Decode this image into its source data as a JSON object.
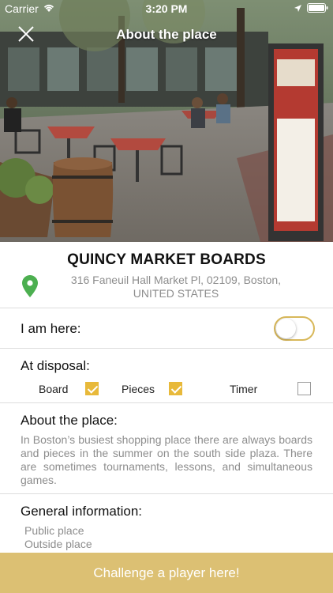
{
  "status_bar": {
    "carrier": "Carrier",
    "time": "3:20 PM"
  },
  "nav": {
    "title": "About the place"
  },
  "place": {
    "name": "QUINCY MARKET BOARDS",
    "address": "316 Faneuil Hall Market Pl, 02109, Boston, UNITED STATES"
  },
  "presence": {
    "label": "I am here:",
    "toggled": false
  },
  "disposal": {
    "label": "At disposal:",
    "options": [
      {
        "label": "Board",
        "checked": true
      },
      {
        "label": "Pieces",
        "checked": true
      },
      {
        "label": "Timer",
        "checked": false
      }
    ]
  },
  "about": {
    "label": "About the place:",
    "text": "In Boston’s busiest shopping place there are always boards and pieces in the summer on the south side plaza. There are sometimes tournaments, lessons, and simultaneous games."
  },
  "general": {
    "label": "General information:",
    "items": [
      "Public place",
      "Outside place"
    ]
  },
  "cta": {
    "label": "Challenge a player here!"
  },
  "colors": {
    "accent": "#e8b93a",
    "cta_bg": "#dcc073",
    "pin": "#4caf50"
  },
  "icons": [
    "wifi-icon",
    "location-arrow-icon",
    "battery-icon",
    "close-icon",
    "map-pin-icon"
  ]
}
